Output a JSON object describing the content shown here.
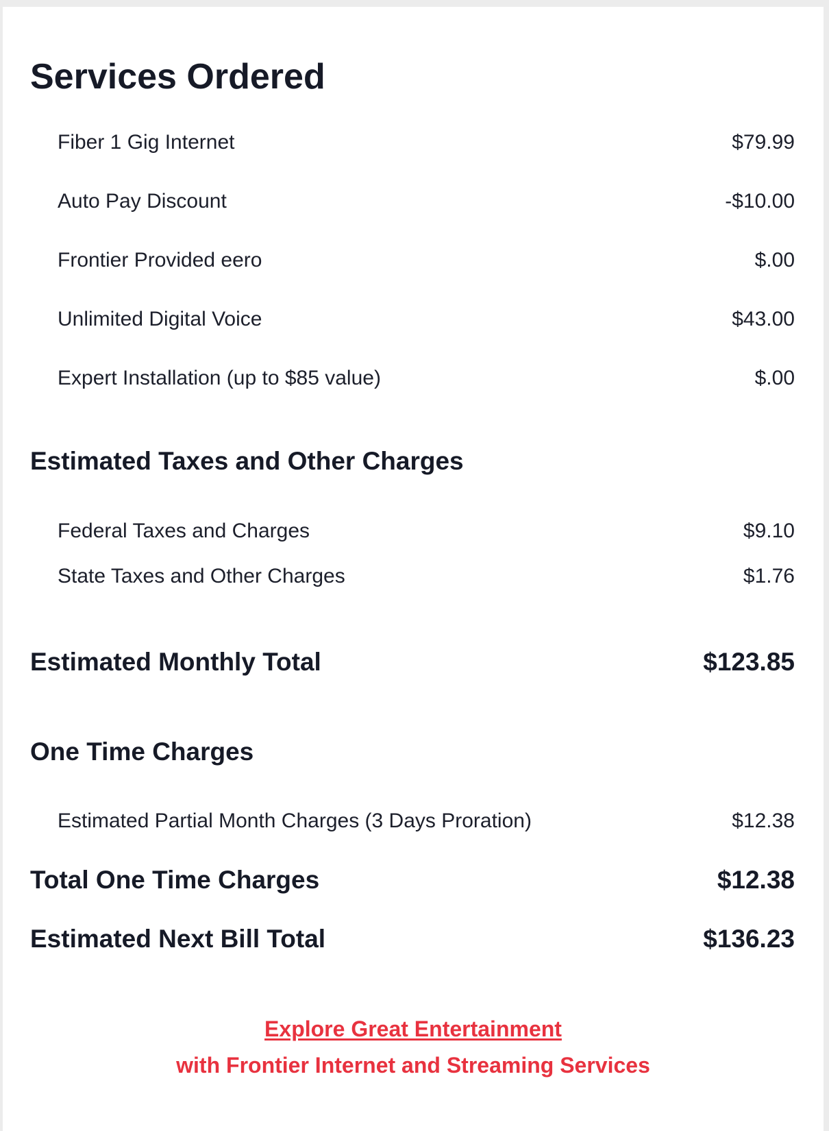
{
  "services": {
    "title": "Services Ordered",
    "items": [
      {
        "label": "Fiber 1 Gig Internet",
        "amount": "$79.99"
      },
      {
        "label": "Auto Pay Discount",
        "amount": "-$10.00"
      },
      {
        "label": "Frontier Provided eero",
        "amount": "$.00"
      },
      {
        "label": "Unlimited Digital Voice",
        "amount": "$43.00"
      },
      {
        "label": "Expert Installation (up to $85 value)",
        "amount": "$.00"
      }
    ]
  },
  "taxes": {
    "title": "Estimated Taxes and Other Charges",
    "items": [
      {
        "label": "Federal Taxes and Charges",
        "amount": "$9.10"
      },
      {
        "label": "State Taxes and Other Charges",
        "amount": "$1.76"
      }
    ]
  },
  "monthly_total": {
    "label": "Estimated Monthly Total",
    "amount": "$123.85"
  },
  "one_time": {
    "title": "One Time Charges",
    "items": [
      {
        "label": "Estimated Partial Month Charges (3 Days Proration)",
        "amount": "$12.38"
      }
    ]
  },
  "one_time_total": {
    "label": "Total One Time Charges",
    "amount": "$12.38"
  },
  "next_bill_total": {
    "label": "Estimated Next Bill Total",
    "amount": "$136.23"
  },
  "promo": {
    "link_text": "Explore Great Entertainment",
    "subtext": "with Frontier Internet and Streaming Services"
  },
  "colors": {
    "accent_red": "#e8323f",
    "text_dark": "#161a27",
    "background": "#ececec"
  }
}
